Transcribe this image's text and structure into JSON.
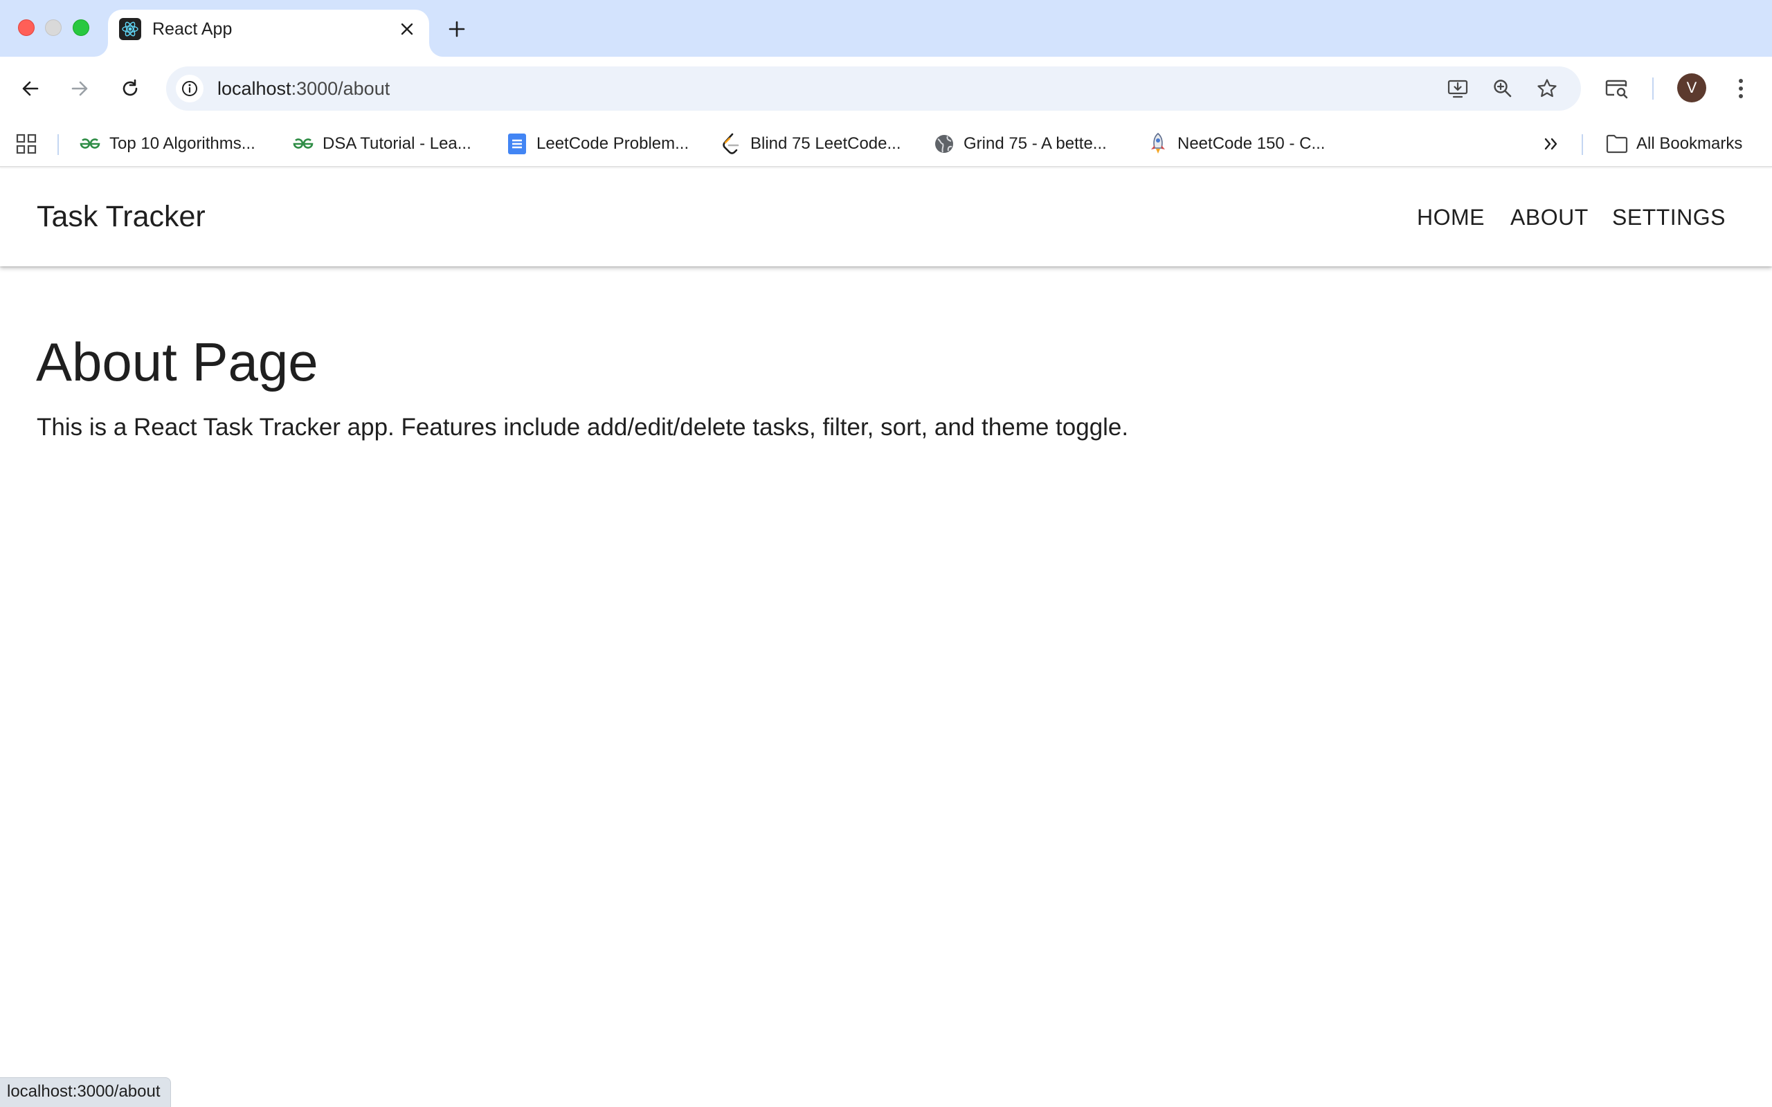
{
  "browser": {
    "tab": {
      "title": "React App",
      "favicon": "react-icon"
    },
    "omnibox": {
      "host": "localhost",
      "path": ":3000/about"
    },
    "avatar_letter": "V",
    "bookmarks": [
      {
        "label": "Top 10 Algorithms...",
        "icon": "geeksforgeeks-icon"
      },
      {
        "label": "DSA Tutorial - Lea...",
        "icon": "geeksforgeeks-icon"
      },
      {
        "label": "LeetCode Problem...",
        "icon": "google-docs-icon"
      },
      {
        "label": "Blind 75 LeetCode...",
        "icon": "leetcode-icon"
      },
      {
        "label": "Grind 75 - A bette...",
        "icon": "globe-icon"
      },
      {
        "label": "NeetCode 150 - C...",
        "icon": "rocket-icon"
      }
    ],
    "all_bookmarks_label": "All Bookmarks",
    "status_url": "localhost:3000/about"
  },
  "app": {
    "brand": "Task Tracker",
    "nav": [
      "HOME",
      "ABOUT",
      "SETTINGS"
    ]
  },
  "page": {
    "title": "About Page",
    "description": "This is a React Task Tracker app. Features include add/edit/delete tasks, filter, sort, and theme toggle."
  },
  "colors": {
    "tabstrip": "#d3e3fd",
    "omnibox": "#edf2fa",
    "avatar": "#5c3a2e",
    "text": "#1f1f1f"
  }
}
